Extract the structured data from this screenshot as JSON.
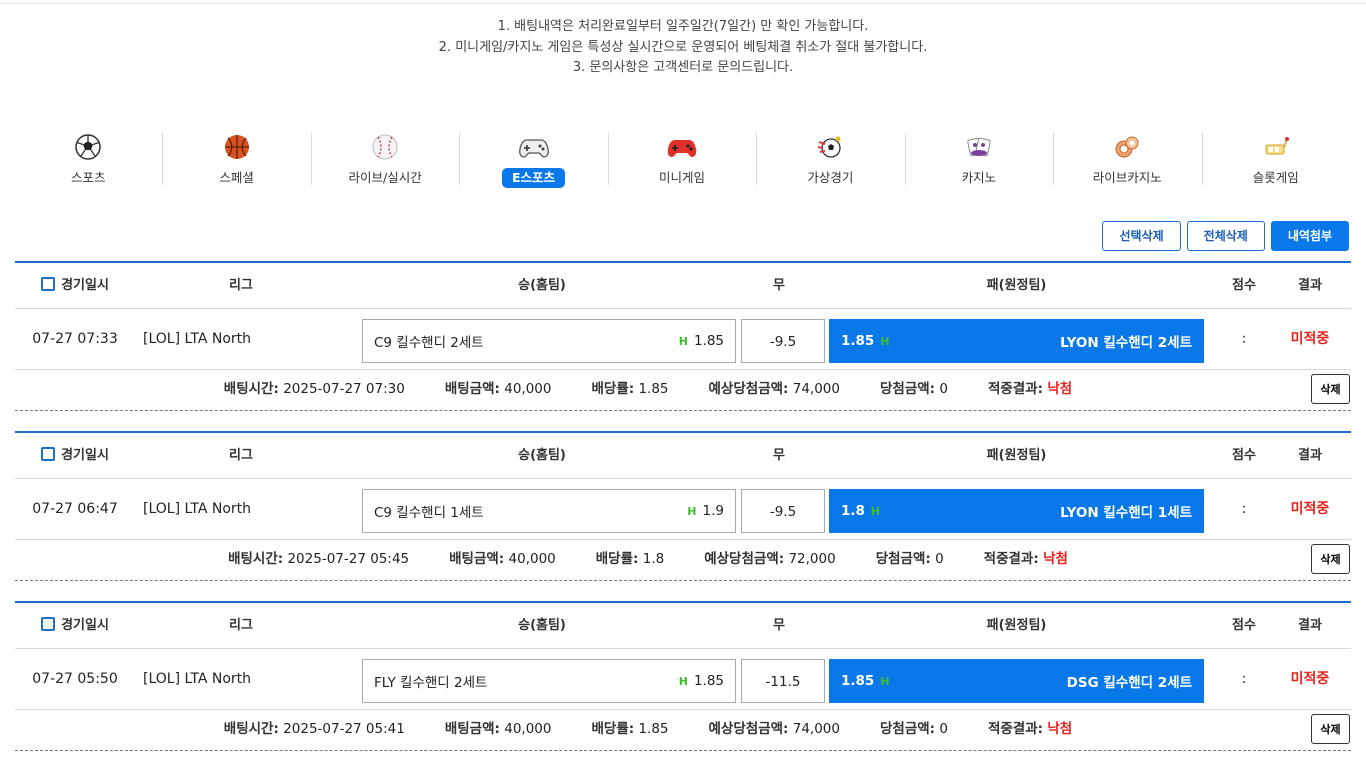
{
  "notices": [
    "1. 배팅내역은 처리완료일부터 일주일간(7일간) 만 확인 가능합니다.",
    "2. 미니게임/카지노 게임은 특성상 실시간으로 운영되어 베팅체결 취소가 절대 불가합니다.",
    "3. 문의사항은 고객센터로 문의드립니다."
  ],
  "categories": [
    {
      "label": "스포츠",
      "icon": "soccer-ball-icon"
    },
    {
      "label": "스페셜",
      "icon": "basketball-icon"
    },
    {
      "label": "라이브/실시간",
      "icon": "baseball-icon"
    },
    {
      "label": "E스포츠",
      "icon": "gamepad-icon",
      "active": true
    },
    {
      "label": "미니게임",
      "icon": "red-gamepad-icon"
    },
    {
      "label": "가상경기",
      "icon": "virtual-soccer-icon"
    },
    {
      "label": "카지노",
      "icon": "cards-icon"
    },
    {
      "label": "라이브카지노",
      "icon": "chips-icon"
    },
    {
      "label": "슬롯게임",
      "icon": "slot-icon"
    }
  ],
  "actions": {
    "select_delete": "선택삭제",
    "delete_all": "전체삭제",
    "attach_history": "내역첨부"
  },
  "headers": {
    "date": "경기일시",
    "league": "리그",
    "home": "승(홈팀)",
    "draw": "무",
    "away": "패(원정팀)",
    "score": "점수",
    "result": "결과"
  },
  "labels": {
    "bet_time": "배팅시간:",
    "bet_amount": "배팅금액:",
    "odds": "배당률:",
    "expected": "예상당첨금액:",
    "win_amount": "당첨금액:",
    "hit_result": "적중결과:",
    "delete": "삭제",
    "handicap": "H"
  },
  "bets": [
    {
      "date": "07-27 07:33",
      "league": "[LOL] LTA North",
      "home": "C9 킬수핸디 2세트",
      "home_odds": "1.85",
      "draw": "-9.5",
      "away": "LYON 킬수핸디 2세트",
      "away_odds": "1.85",
      "score": ":",
      "result": "미적중",
      "bet_time": "2025-07-27 07:30",
      "bet_amount": "40,000",
      "odds": "1.85",
      "expected": "74,000",
      "win_amount": "0",
      "hit_result": "낙첨"
    },
    {
      "date": "07-27 06:47",
      "league": "[LOL] LTA North",
      "home": "C9 킬수핸디 1세트",
      "home_odds": "1.9",
      "draw": "-9.5",
      "away": "LYON 킬수핸디 1세트",
      "away_odds": "1.8",
      "score": ":",
      "result": "미적중",
      "bet_time": "2025-07-27 05:45",
      "bet_amount": "40,000",
      "odds": "1.8",
      "expected": "72,000",
      "win_amount": "0",
      "hit_result": "낙첨"
    },
    {
      "date": "07-27 05:50",
      "league": "[LOL] LTA North",
      "home": "FLY 킬수핸디 2세트",
      "home_odds": "1.85",
      "draw": "-11.5",
      "away": "DSG 킬수핸디 2세트",
      "away_odds": "1.85",
      "score": ":",
      "result": "미적중",
      "bet_time": "2025-07-27 05:41",
      "bet_amount": "40,000",
      "odds": "1.85",
      "expected": "74,000",
      "win_amount": "0",
      "hit_result": "낙첨"
    }
  ],
  "colors": {
    "accent": "#0a78e8",
    "loss": "#e8231e",
    "handicap": "#3fbf2a"
  }
}
